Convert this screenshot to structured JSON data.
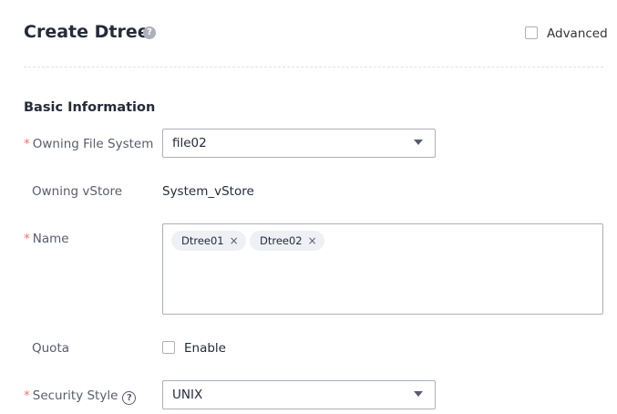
{
  "header": {
    "title": "Create Dtree",
    "help_glyph": "?",
    "advanced_label": "Advanced",
    "advanced_checked": false
  },
  "basic": {
    "section_title": "Basic Information",
    "required_mark": "*",
    "owning_fs": {
      "label": "Owning File System",
      "value": "file02"
    },
    "owning_vstore": {
      "label": "Owning vStore",
      "value": "System_vStore"
    },
    "name": {
      "label": "Name",
      "tags": [
        "Dtree01",
        "Dtree02"
      ],
      "remove_glyph": "×"
    },
    "quota": {
      "label": "Quota",
      "option_label": "Enable",
      "checked": false
    },
    "security_style": {
      "label": "Security Style",
      "help_glyph": "?",
      "value": "UNIX"
    }
  },
  "colors": {
    "required": "#f66f6a",
    "border": "#adb0b8",
    "tag_bg": "#eef0f5",
    "title": "#252b3a"
  }
}
